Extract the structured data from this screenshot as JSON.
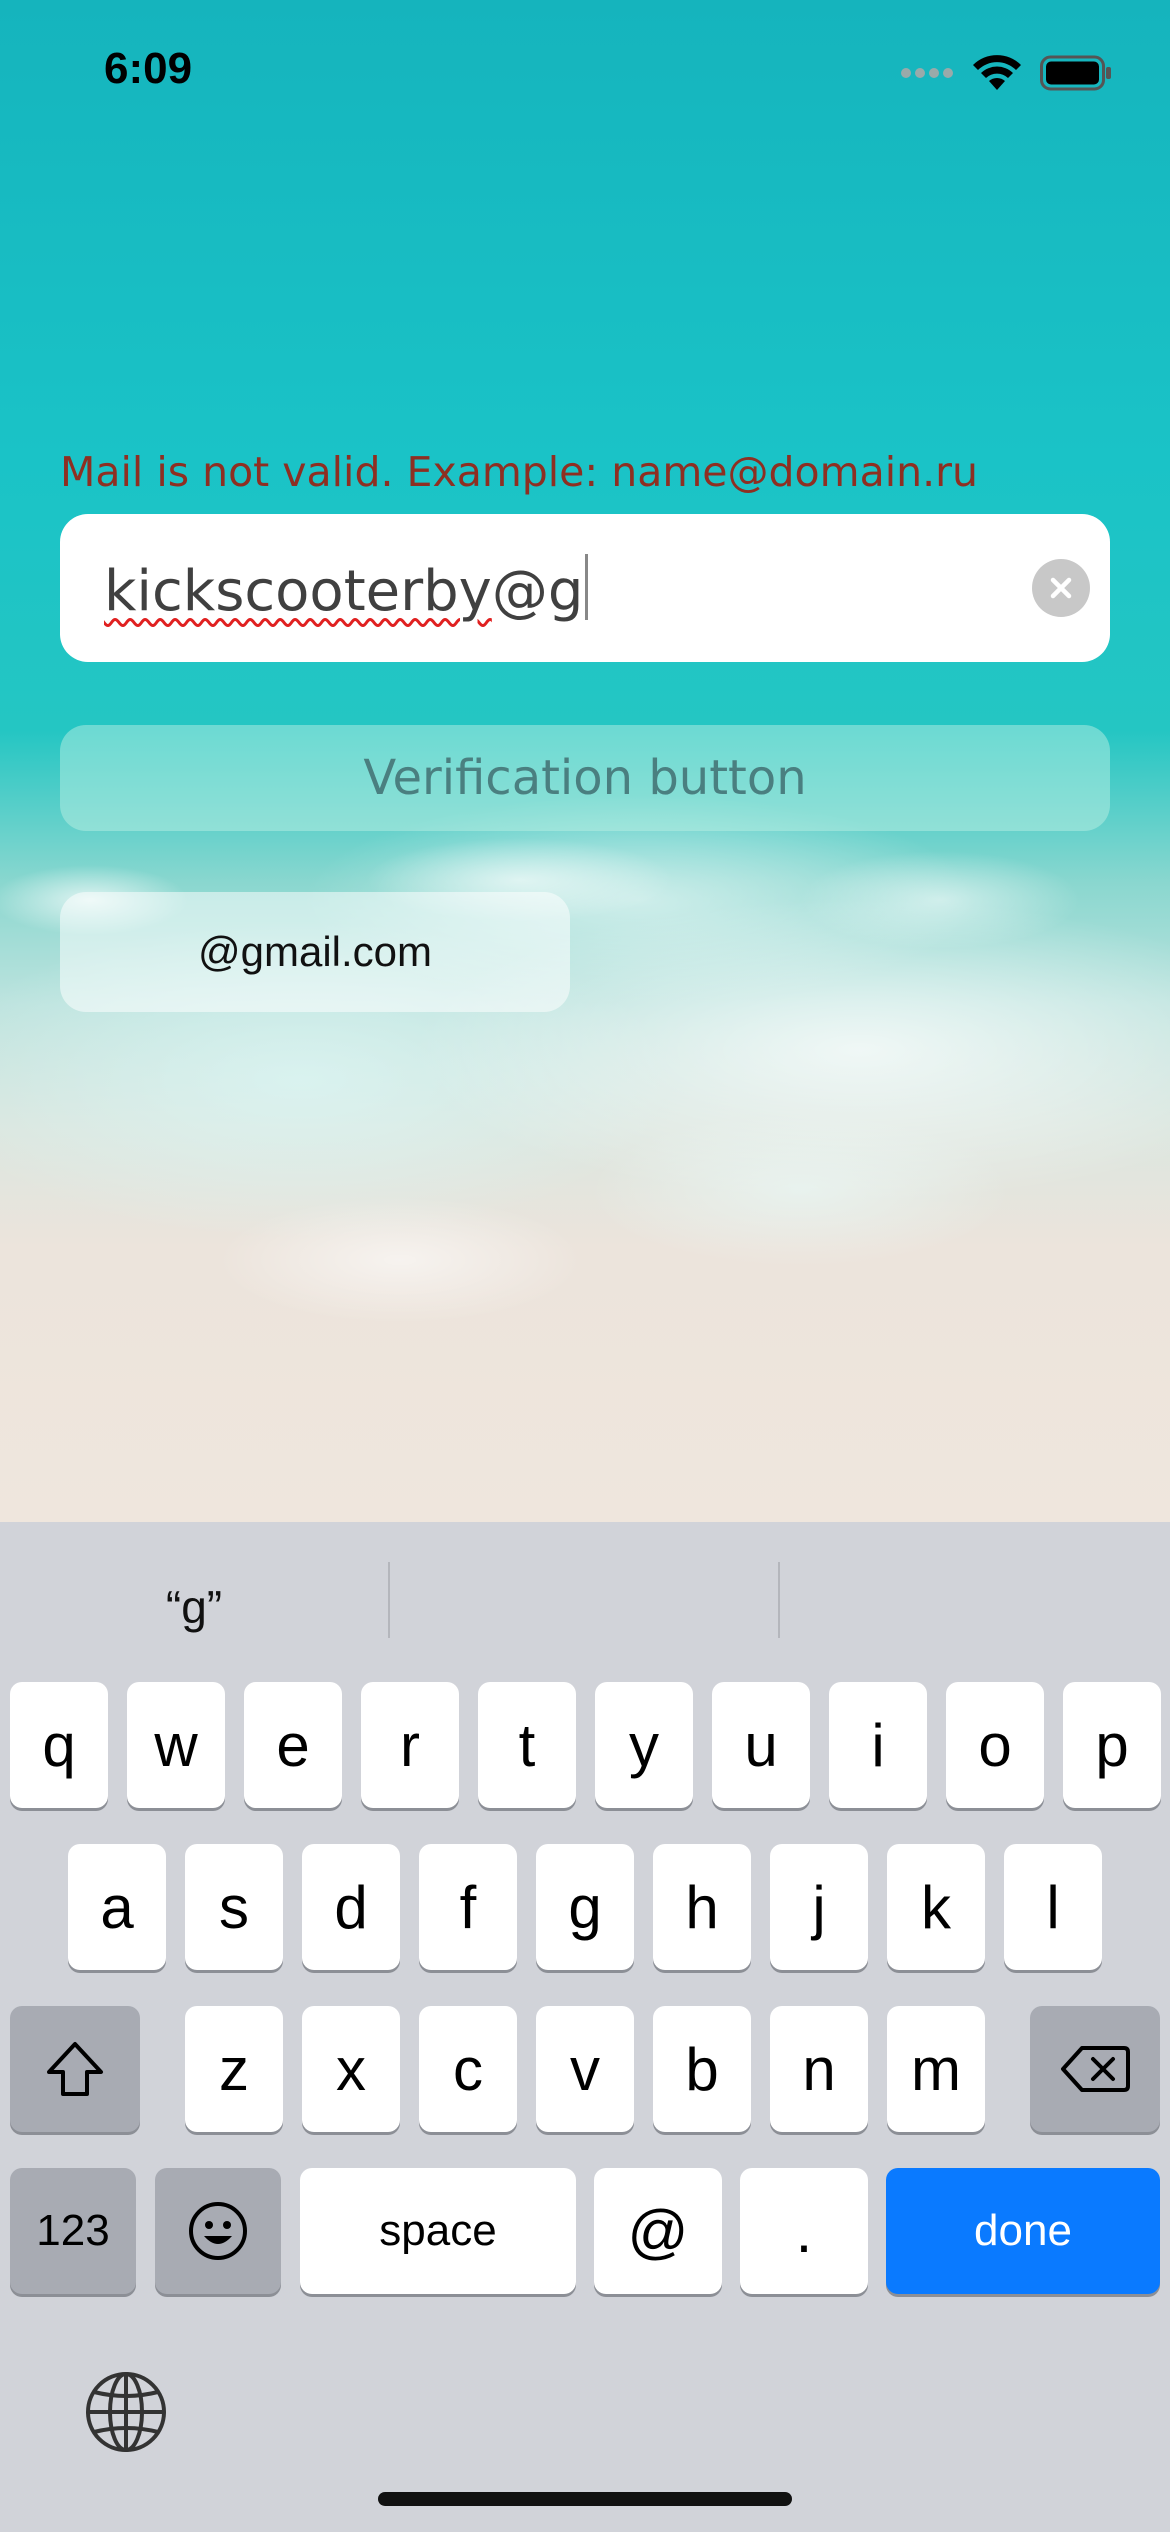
{
  "status_bar": {
    "time": "6:09"
  },
  "form": {
    "error_message": "Mail is not valid. Example: name@domain.ru",
    "email_value_underlined": "kickscooterby",
    "email_value_rest": "@g",
    "verify_button_label": "Verification button",
    "suggestion_label": "@gmail.com"
  },
  "keyboard": {
    "predictions": [
      "“g”",
      "",
      ""
    ],
    "row1": [
      "q",
      "w",
      "e",
      "r",
      "t",
      "y",
      "u",
      "i",
      "o",
      "p"
    ],
    "row2": [
      "a",
      "s",
      "d",
      "f",
      "g",
      "h",
      "j",
      "k",
      "l"
    ],
    "row3": [
      "z",
      "x",
      "c",
      "v",
      "b",
      "n",
      "m"
    ],
    "numbers_label": "123",
    "space_label": "space",
    "at_label": "@",
    "dot_label": ".",
    "done_label": "done"
  },
  "colors": {
    "error_text": "#8e2f22",
    "done_key": "#0a7aff",
    "keyboard_bg": "#d1d3d9"
  },
  "icons": {
    "status": [
      "cellular-signal-icon",
      "wifi-icon",
      "battery-icon"
    ],
    "field": "clear-icon",
    "keyboard": [
      "shift-icon",
      "delete-icon",
      "emoji-icon",
      "globe-icon"
    ]
  }
}
